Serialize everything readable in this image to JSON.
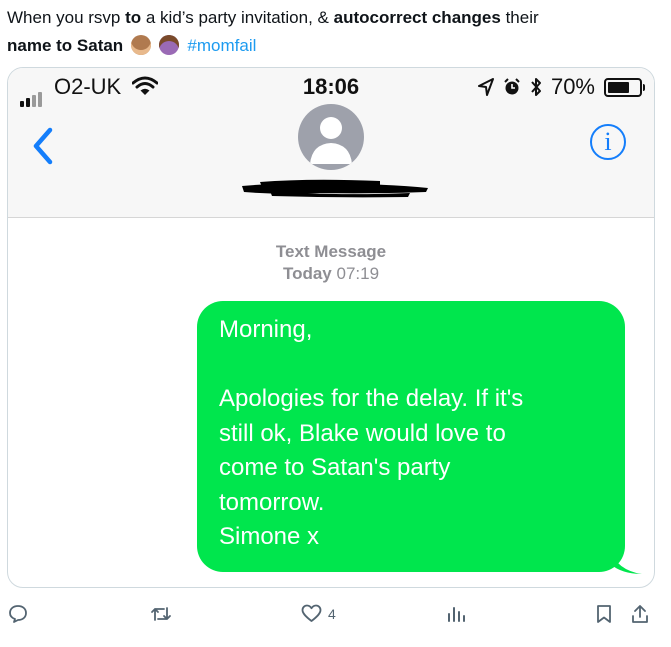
{
  "tweet": {
    "text_part1": "When you rsvp ",
    "text_bold1": "to",
    "text_part2": " a kid’s party invitation, & ",
    "text_bold2": "autocorrect changes",
    "text_part3": " their ",
    "text_bold3": "name to Satan",
    "emoji1": "see-no-evil-monkey",
    "emoji2": "woman-facepalming",
    "hashtag": "#momfail"
  },
  "status_bar": {
    "carrier": "O2-UK",
    "time": "18:06",
    "battery": "70%",
    "battery_level": 0.7
  },
  "conversation": {
    "label": "Text Message",
    "date_day": "Today",
    "date_time": "07:19",
    "message_lines": [
      "Morning,",
      "",
      "Apologies for the delay. If it's",
      "still ok, Blake would love to",
      "come to Satan's party",
      "tomorrow.",
      "Simone x"
    ]
  },
  "actions": {
    "likes": "4"
  },
  "colors": {
    "bubble": "#00e64d",
    "ios_blue": "#147efb",
    "link_blue": "#1d9bf0"
  }
}
